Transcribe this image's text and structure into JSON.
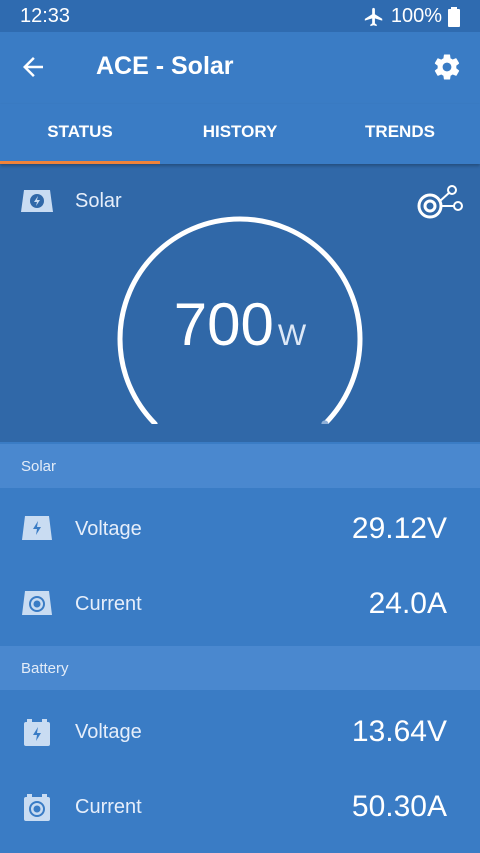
{
  "statusbar": {
    "time": "12:33",
    "battery": "100%"
  },
  "appbar": {
    "title": "ACE - Solar"
  },
  "tabs": [
    {
      "label": "STATUS"
    },
    {
      "label": "HISTORY"
    },
    {
      "label": "TRENDS"
    }
  ],
  "hero": {
    "source_label": "Solar",
    "power_value": "700",
    "power_unit": "W",
    "gauge_level": 1.0
  },
  "sections": [
    {
      "title": "Solar",
      "rows": [
        {
          "label": "Voltage",
          "value": "29.12V"
        },
        {
          "label": "Current",
          "value": "24.0A"
        }
      ]
    },
    {
      "title": "Battery",
      "rows": [
        {
          "label": "Voltage",
          "value": "13.64V"
        },
        {
          "label": "Current",
          "value": "50.30A"
        }
      ]
    }
  ],
  "colors": {
    "primary": "#3a7cc5",
    "dark": "#3068a8",
    "section": "#4a88cf",
    "tab_indicator": "#f0833a"
  },
  "icons": [
    "airplane-icon",
    "battery-icon",
    "back-arrow-icon",
    "gear-icon",
    "solar-panel-icon",
    "connection-icon",
    "voltage-icon",
    "current-icon",
    "battery-voltage-icon",
    "battery-current-icon"
  ]
}
